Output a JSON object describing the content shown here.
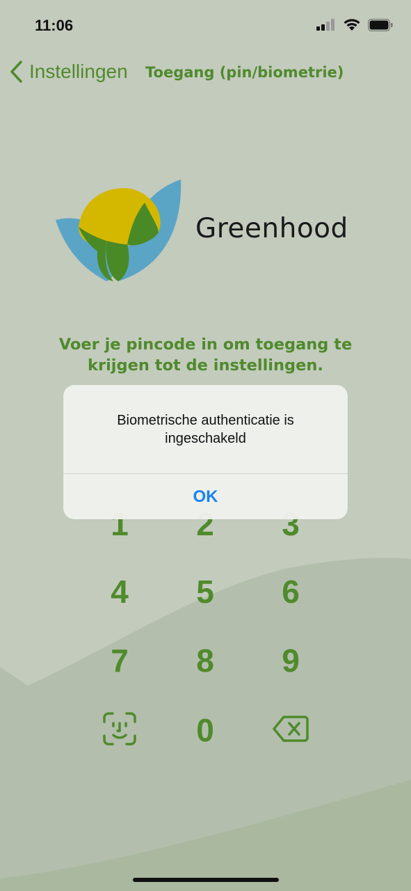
{
  "status_bar": {
    "time": "11:06",
    "icons": [
      "cellular-signal-icon",
      "wifi-icon",
      "battery-icon"
    ]
  },
  "nav": {
    "back_label": "Instellingen",
    "title": "Toegang (pin/biometrie)"
  },
  "logo": {
    "brand_name": "Greenhood"
  },
  "instruction": {
    "line1": "Voer je pincode in om toegang te",
    "line2": "krijgen tot de instellingen."
  },
  "keypad": {
    "k1": "1",
    "k2": "2",
    "k3": "3",
    "k4": "4",
    "k5": "5",
    "k6": "6",
    "k7": "7",
    "k8": "8",
    "k9": "9",
    "k0": "0",
    "face_id_icon": "face-id-icon",
    "delete_icon": "backspace-icon"
  },
  "dialog": {
    "message_line1": "Biometrische authenticatie is",
    "message_line2": "ingeschakeld",
    "ok_label": "OK"
  },
  "colors": {
    "background": "#c3cbbd",
    "accent_green": "#4f8a2c",
    "ios_blue": "#1a82f0",
    "logo_blue": "#5aa5c6",
    "logo_yellow": "#d4b800",
    "logo_green": "#4a8a26"
  }
}
